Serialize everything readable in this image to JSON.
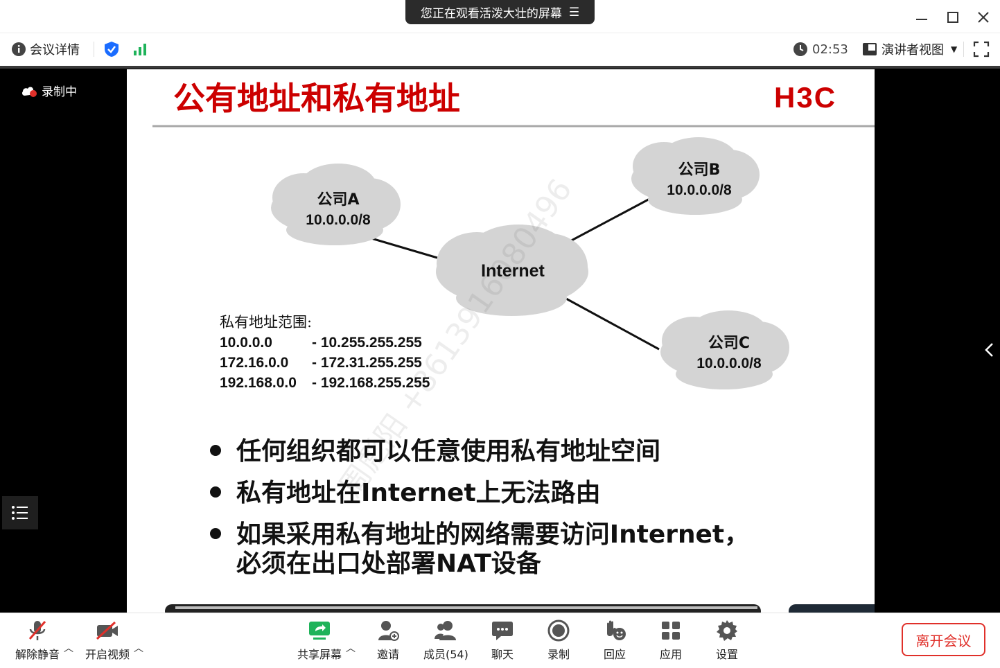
{
  "window": {
    "share_banner": "您正在观看活泼大壮的屏幕"
  },
  "infobar": {
    "meeting_details": "会议详情",
    "timer": "02:53",
    "view_mode": "演讲者视图"
  },
  "stage": {
    "recording": "录制中"
  },
  "slide": {
    "title": "公有地址和私有地址",
    "logo": "H3C",
    "cloud_a_name": "公司A",
    "cloud_a_net": "10.0.0.0/8",
    "cloud_b_name": "公司B",
    "cloud_b_net": "10.0.0.0/8",
    "cloud_c_name": "公司C",
    "cloud_c_net": "10.0.0.0/8",
    "cloud_center": "Internet",
    "ranges_title": "私有地址范围:",
    "ranges": [
      {
        "start": "10.0.0.0",
        "end": "- 10.255.255.255"
      },
      {
        "start": "172.16.0.0",
        "end": "- 172.31.255.255"
      },
      {
        "start": "192.168.0.0",
        "end": "- 192.168.255.255"
      }
    ],
    "bullets": [
      "任何组织都可以任意使用私有地址空间",
      "私有地址在Internet上无法路由",
      "如果采用私有地址的网络需要访问Internet，",
      "必须在出口处部署NAT设备"
    ],
    "watermark": "周彪阳 +8613916080496"
  },
  "toolbar": {
    "unmute": "解除静音",
    "start_video": "开启视频",
    "share_screen": "共享屏幕",
    "invite": "邀请",
    "members": "成员(54)",
    "chat": "聊天",
    "record": "录制",
    "react": "回应",
    "apps": "应用",
    "settings": "设置",
    "leave": "离开会议"
  },
  "colors": {
    "title_red": "#cc0000",
    "leave_red": "#e0302a",
    "shield_blue": "#1a6cff",
    "signal_green": "#1fb35a",
    "share_green": "#1fb35a",
    "cloud_gray": "#d4d4d4"
  }
}
